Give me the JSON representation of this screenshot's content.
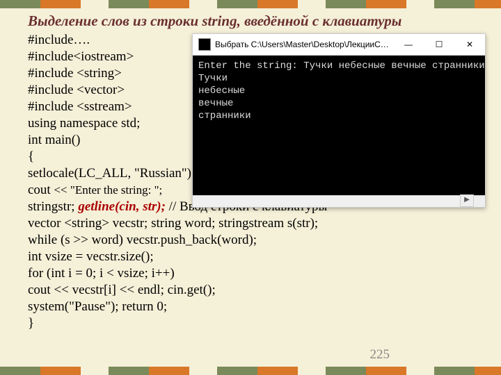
{
  "pattern_colors": [
    "#7a8a5a",
    "#d87828",
    "#f5f0d8",
    "#7a8a5a",
    "#d87828",
    "#f5f0d8",
    "#7a8a5a",
    "#d87828",
    "#f5f0d8",
    "#7a8a5a",
    "#d87828",
    "#f5f0d8",
    "#7a8a5a",
    "#d87828"
  ],
  "title": "Выделение слов из строки string, введённой с клавиатуры",
  "code_lines": [
    {
      "segments": [
        {
          "t": "#include…."
        }
      ]
    },
    {
      "segments": [
        {
          "t": "#include<iostream>"
        }
      ]
    },
    {
      "segments": [
        {
          "t": "#include <string>"
        }
      ]
    },
    {
      "segments": [
        {
          "t": "#include <vector>"
        }
      ]
    },
    {
      "segments": [
        {
          "t": "#include <sstream>"
        }
      ]
    },
    {
      "segments": [
        {
          "t": " using namespace std;"
        }
      ]
    },
    {
      "segments": [
        {
          "t": "int main()"
        }
      ]
    },
    {
      "segments": [
        {
          "t": "{"
        }
      ]
    },
    {
      "segments": [
        {
          "t": "setlocale(LC_ALL, \"Russian\");"
        }
      ]
    },
    {
      "segments": [
        {
          "t": "cout "
        },
        {
          "t": "<< \"Enter the string: \";",
          "cls": "small-normal"
        }
      ]
    },
    {
      "segments": [
        {
          "t": "stringstr; "
        },
        {
          "t": "getline(cin, str); ",
          "cls": "redbold"
        },
        {
          "t": "// Ввод строки с клавиатуры"
        }
      ]
    },
    {
      "segments": [
        {
          "t": "vector <string> vecstr;    string word; stringstream s(str);"
        }
      ]
    },
    {
      "segments": [
        {
          "t": "while (s >> word) vecstr.push_back(word);"
        }
      ]
    },
    {
      "segments": [
        {
          "t": "int vsize = vecstr.size();"
        }
      ]
    },
    {
      "segments": [
        {
          "t": "for (int i = 0; i < vsize; i++)"
        }
      ]
    },
    {
      "segments": [
        {
          "t": "cout <<  vecstr[i] << endl;    cin.get();"
        }
      ]
    },
    {
      "segments": [
        {
          "t": "system(\"Pause\");  return 0;"
        }
      ]
    },
    {
      "segments": [
        {
          "t": "}"
        }
      ]
    }
  ],
  "page_number": "225",
  "console": {
    "window_title": "Выбрать C:\\Users\\Master\\Desktop\\ЛекцииC++…",
    "min_label": "—",
    "max_label": "☐",
    "close_label": "✕",
    "lines": [
      "Enter the string: Тучки небесные вечные странники",
      "Тучки",
      "небесные",
      "вечные",
      "странники"
    ]
  }
}
